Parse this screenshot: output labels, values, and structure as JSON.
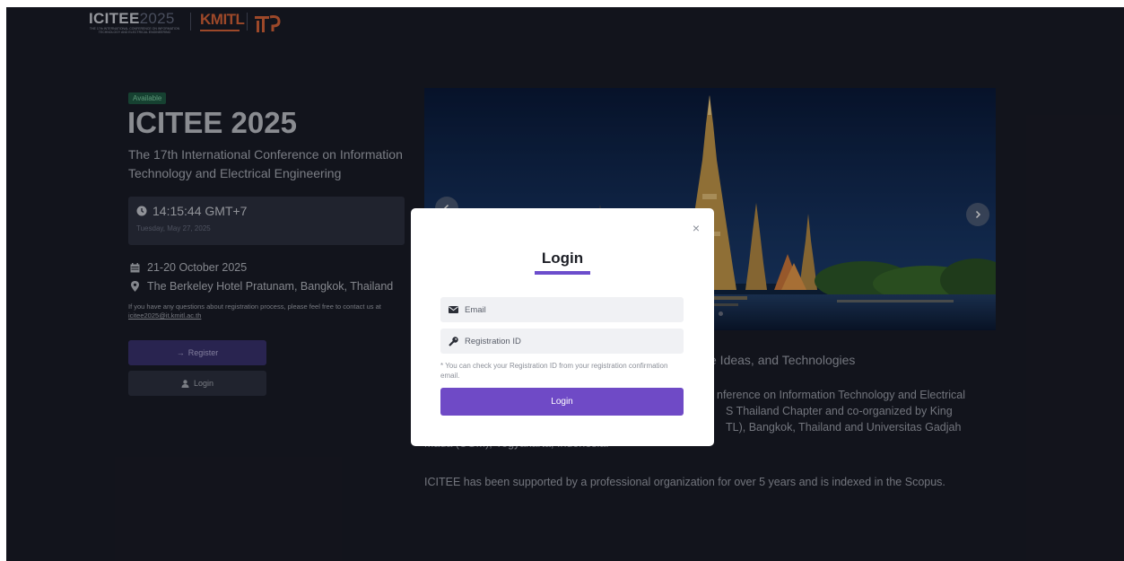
{
  "header": {
    "logo_title": "ICITEE",
    "logo_year": "2025",
    "logo_caption": "THE 17th INTERNATIONAL CONFERENCE ON INFORMATION TECHNOLOGY AND ELECTRICAL ENGINEERING",
    "kmitl_logo": "KMITL",
    "it_logo": "iT"
  },
  "event": {
    "status_badge": "Available",
    "title": "ICITEE 2025",
    "subtitle": "The 17th International Conference on Information Technology and Electrical Engineering",
    "time": "14:15:44 GMT+7",
    "date": "Tuesday, May 27, 2025",
    "dates_range": "21-20 October 2025",
    "venue": "The Berkeley Hotel Pratunam, Bangkok, Thailand",
    "contact_text": "If you have any questions about registration process, please feel free to contact us at",
    "contact_email": "icitee2025@it.kmitl.ac.th",
    "register_label": "Register",
    "login_label": "Login"
  },
  "carousel": {
    "slide_count": 3,
    "active_index": 0
  },
  "description": {
    "heading_fragment": "ve Ideas, and Technologies",
    "para1_line1": "nference on Information Technology and Electrical",
    "para1_line2": "S Thailand Chapter and co-organized by King",
    "para1_line3": "TL), Bangkok, Thailand and Universitas Gadjah",
    "para1_line4": "Mada (UGM), Yogyakarta, Indonesia.",
    "para2": "ICITEE has been supported by a professional organization for over 5 years and is indexed in the Scopus."
  },
  "modal": {
    "close_symbol": "×",
    "title": "Login",
    "email_placeholder": "Email",
    "regid_placeholder": "Registration ID",
    "hint": "* You can check your Registration ID from your registration confirmation email.",
    "submit_label": "Login"
  },
  "colors": {
    "background": "#1a1c27",
    "accent": "#6f4ac6",
    "badge": "#1f5a44"
  }
}
